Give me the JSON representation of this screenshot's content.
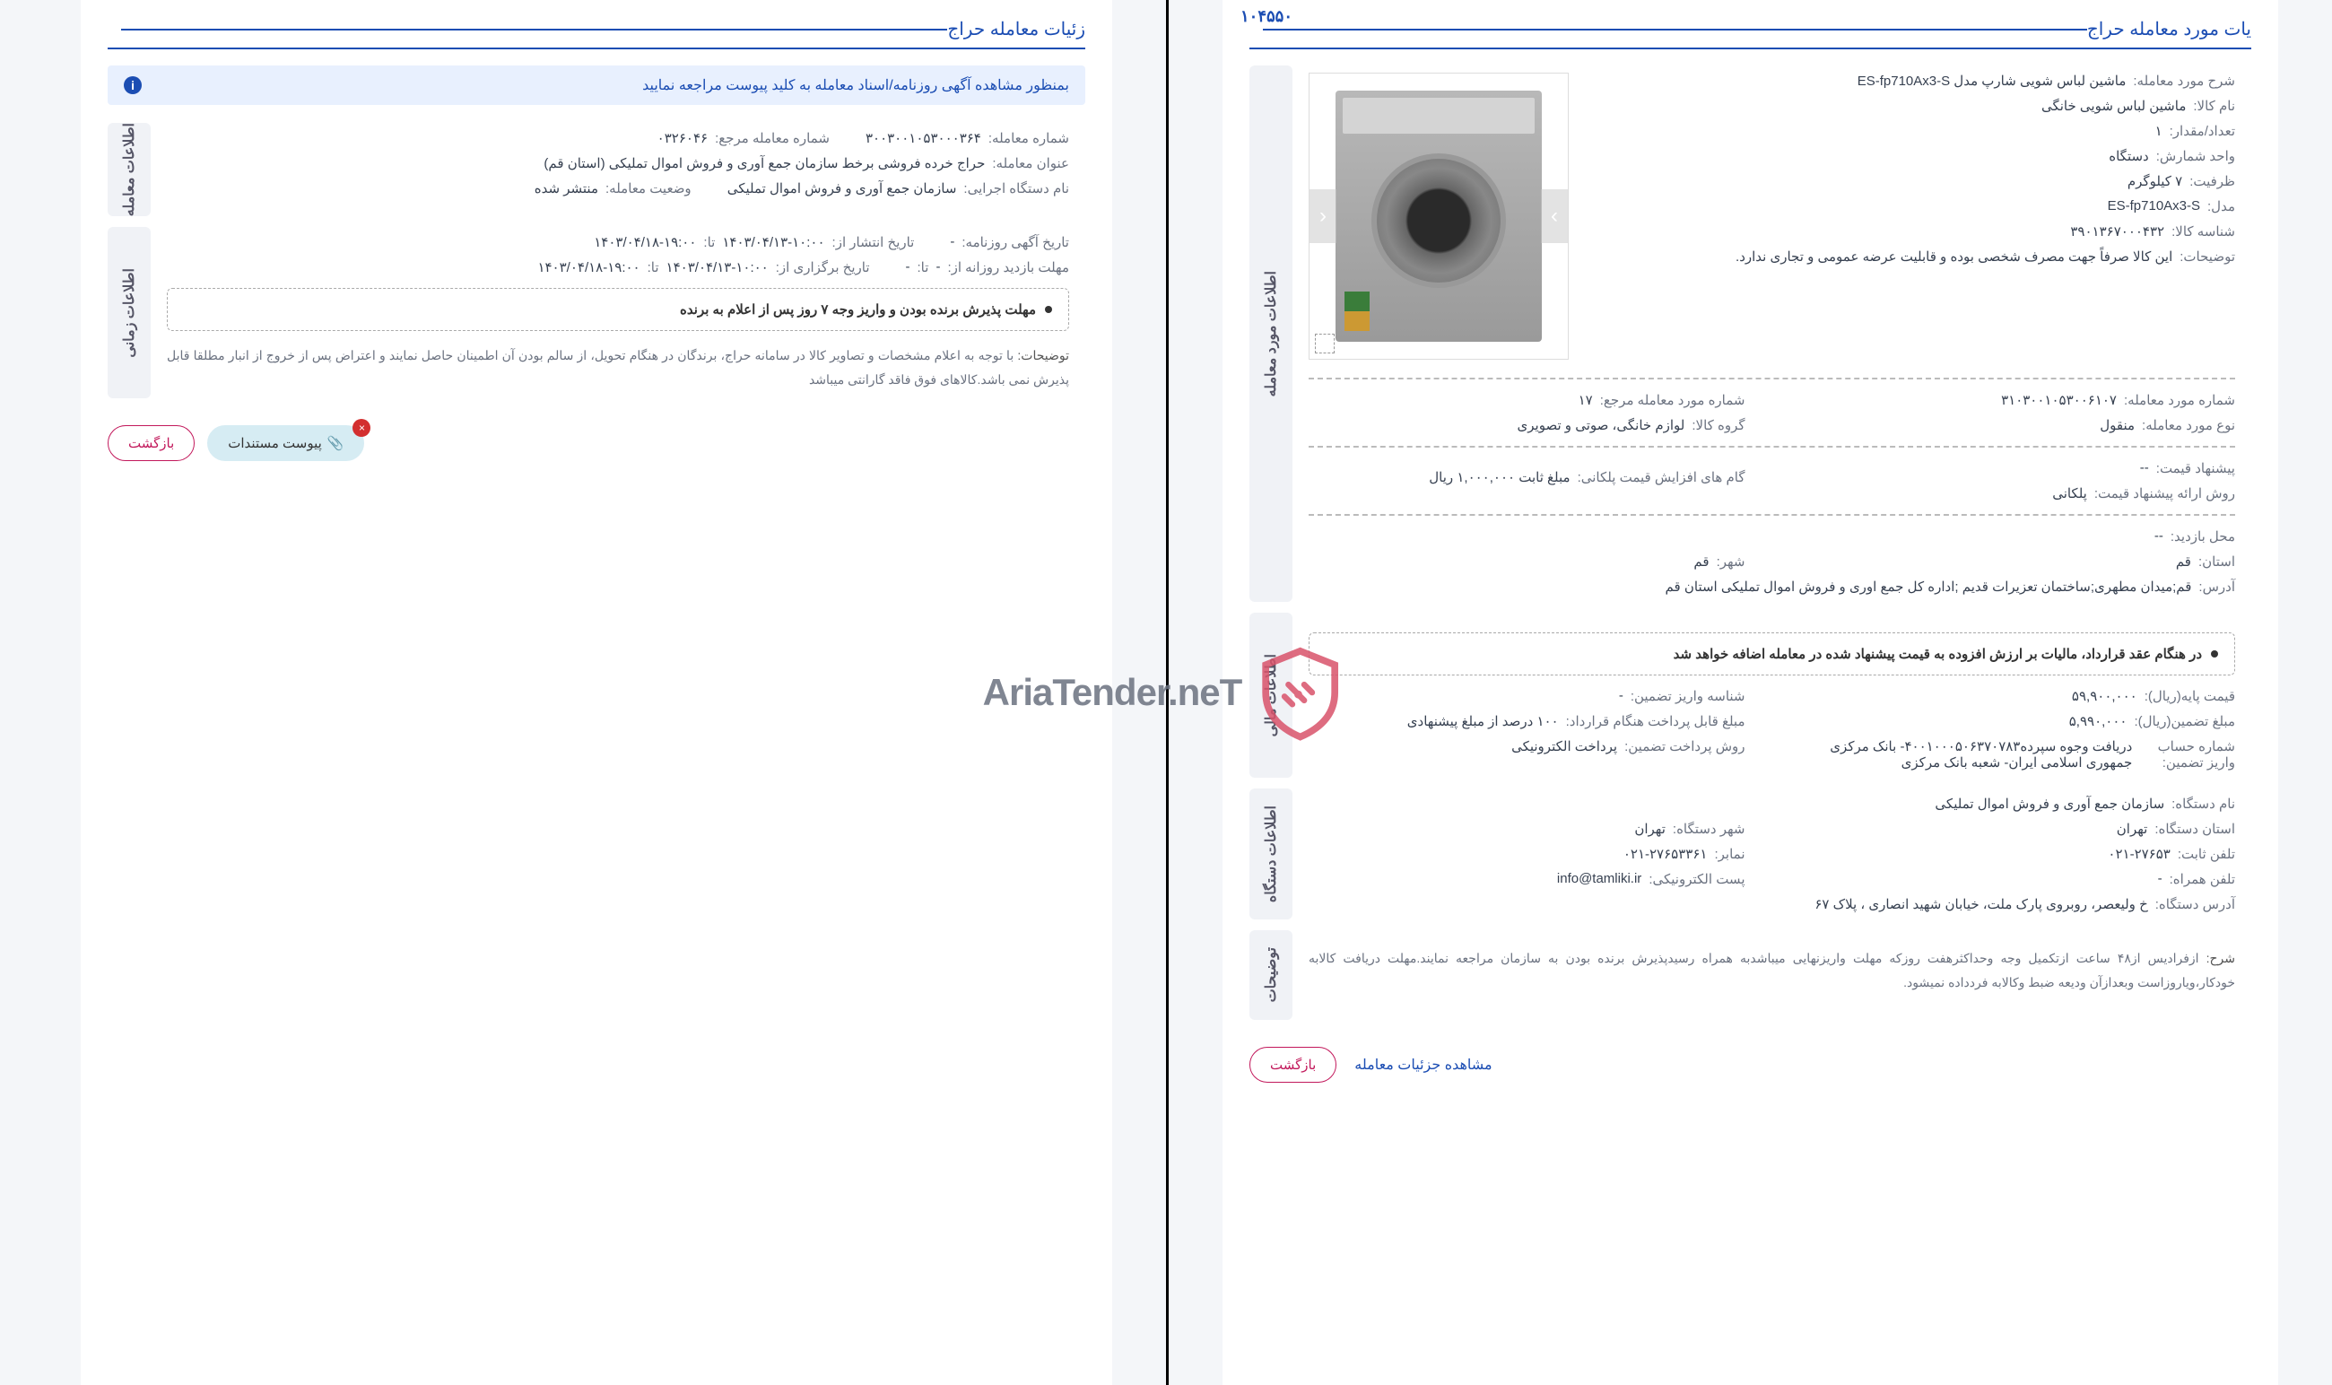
{
  "page_number": "۱۰۴۵۵۰",
  "left": {
    "header": "زئیات معامله حراج",
    "banner": "بمنظور مشاهده آگهی روزنامه/اسناد معامله به کلید پیوست مراجعه نمایید",
    "box_transaction": {
      "tab": "اطلاعات معامله",
      "fields": {
        "num_label": "شماره معامله:",
        "num_value": "۳۰۰۳۰۰۱۰۵۳۰۰۰۳۶۴",
        "ref_label": "شماره معامله مرجع:",
        "ref_value": "۰۳۲۶۰۴۶",
        "subject_label": "عنوان معامله:",
        "subject_value": "حراج خرده فروشی برخط سازمان جمع آوری و فروش اموال تملیکی (استان قم)",
        "org_label": "نام دستگاه اجرایی:",
        "org_value": "سازمان جمع آوری و فروش اموال تملیکی",
        "status_label": "وضعیت معامله:",
        "status_value": "منتشر شده"
      }
    },
    "box_time": {
      "tab": "اطلاعات زمانی",
      "fields": {
        "news_label": "تاریخ آگهی روزنامه:",
        "news_value": "-",
        "pub_label": "تاریخ انتشار از:",
        "pub_value": "۱۴۰۳/۰۴/۱۳-۱۰:۰۰",
        "pub_to": "۱۴۰۳/۰۴/۱۸-۱۹:۰۰",
        "visit_label": "مهلت بازدید روزانه از:",
        "visit_value": "-",
        "visit_to_label": "تا:",
        "visit_to": "-",
        "hold_label": "تاریخ برگزاری از:",
        "hold_value": "۱۴۰۳/۰۴/۱۳-۱۰:۰۰",
        "hold_to": "۱۴۰۳/۰۴/۱۸-۱۹:۰۰",
        "to_label": "تا:"
      },
      "deadline": "مهلت پذیرش برنده بودن و واریز وجه ۷ روز پس از اعلام به برنده",
      "note_label": "توضیحات:",
      "note": "با توجه به اعلام مشخصات و تصاویر کالا در سامانه حراج، برندگان در هنگام تحویل، از سالم بودن آن اطمینان حاصل نمایند و اعتراض پس از خروج از انبار مطلقا قابل پذیرش نمی باشد.کالاهای فوق فاقد گارانتی میباشد"
    },
    "buttons": {
      "attach": "پیوست مستندات",
      "back": "بازگشت"
    }
  },
  "right": {
    "header": "یات مورد معامله حراج",
    "box_item": {
      "tab": "اطلاعات مورد معامله",
      "fields": {
        "desc_label": "شرح مورد معامله:",
        "desc_value": "ماشین لباس شویی شارپ مدل ES-fp710Ax3-S",
        "name_label": "نام کالا:",
        "name_value": "ماشین لباس شویی خانگی",
        "qty_label": "تعداد/مقدار:",
        "qty_value": "۱",
        "unit_label": "واحد شمارش:",
        "unit_value": "دستگاه",
        "cap_label": "ظرفیت:",
        "cap_value": "۷ کیلوگرم",
        "model_label": "مدل:",
        "model_value": "ES-fp710Ax3-S",
        "sku_label": "شناسه کالا:",
        "sku_value": "۳۹۰۱۳۶۷۰۰۰۴۳۲",
        "tnote_label": "توضیحات:",
        "tnote_value": "این کالا صرفاً جهت مصرف شخصی بوده و قابلیت عرضه عمومی و تجاری ندارد.",
        "tnum_label": "شماره مورد معامله:",
        "tnum_value": "۳۱۰۳۰۰۱۰۵۳۰۰۶۱۰۷",
        "tref_label": "شماره مورد معامله مرجع:",
        "tref_value": "۱۷",
        "ttype_label": "نوع مورد معامله:",
        "ttype_value": "منقول",
        "group_label": "گروه کالا:",
        "group_value": "لوازم خانگی، صوتی و تصویری",
        "bid_label": "پیشنهاد قیمت:",
        "bid_value": "--",
        "method_label": "روش ارائه پیشنهاد قیمت:",
        "method_value": "پلکانی",
        "step_label": "گام های افزایش قیمت پلکانی:",
        "step_value": "مبلغ ثابت ۱,۰۰۰,۰۰۰ ریال",
        "vloc_label": "محل بازدید:",
        "vloc_value": "--",
        "prov_label": "استان:",
        "prov_value": "قم",
        "city_label": "شهر:",
        "city_value": "قم",
        "addr_label": "آدرس:",
        "addr_value": "قم;میدان مطهری;ساختمان تعزیرات قدیم ;اداره کل جمع اوری و فروش اموال تملیکی استان قم"
      }
    },
    "box_fin": {
      "tab": "اطلاعات مالی",
      "vat": "در هنگام عقد قرارداد، مالیات بر ارزش افزوده به قیمت پیشنهاد شده در معامله اضافه خواهد شد",
      "fields": {
        "base_label": "قیمت پایه(ریال):",
        "base_value": "۵۹,۹۰۰,۰۰۰",
        "gid_label": "شناسه واریز تضمین:",
        "gid_value": "-",
        "gamount_label": "مبلغ تضمین(ریال):",
        "gamount_value": "۵,۹۹۰,۰۰۰",
        "pay_label": "مبلغ قابل پرداخت هنگام قرارداد:",
        "pay_value": "۱۰۰ درصد از مبلغ پیشنهادی",
        "acc_label": "شماره حساب واریز تضمین:",
        "acc_value": "دریافت وجوه سپرده۴۰۰۱۰۰۰۵۰۶۳۷۰۷۸۳- بانک مرکزی جمهوری اسلامی ایران- شعبه بانک مرکزی",
        "gmethod_label": "روش پرداخت تضمین:",
        "gmethod_value": "پرداخت الکترونیکی"
      }
    },
    "box_org": {
      "tab": "اطلاعات دستگاه",
      "fields": {
        "org_label": "نام دستگاه:",
        "org_value": "سازمان جمع آوری و فروش اموال تملیکی",
        "oprov_label": "استان دستگاه:",
        "oprov_value": "تهران",
        "ocity_label": "شهر دستگاه:",
        "ocity_value": "تهران",
        "tel_label": "تلفن ثابت:",
        "tel_value": "۰۲۱-۲۷۶۵۳",
        "fax_label": "نمابر:",
        "fax_value": "۰۲۱-۲۷۶۵۳۳۶۱",
        "mob_label": "تلفن همراه:",
        "mob_value": "-",
        "email_label": "پست الکترونیکی:",
        "email_value": "info@tamliki.ir",
        "oaddr_label": "آدرس دستگاه:",
        "oaddr_value": "خ ولیعصر، روبروی پارک ملت، خیابان شهید انصاری ، پلاک ۶۷"
      }
    },
    "box_explain": {
      "tab": "توضیحات",
      "label": "شرح:",
      "text": "ازفرادیس از۴۸ ساعت ازتکمیل وجه وحداکثرهفت روزکه مهلت واریزنهایی میباشدبه همراه رسیدپذیرش برنده بودن به سازمان مراجعه نمایند.مهلت دریافت کالابه خودکار،ویاروزاست وبعدازآن ودیعه ضبط وکالابه فردداده نمیشود."
    },
    "buttons": {
      "link": "مشاهده جزئیات معامله",
      "back": "بازگشت"
    }
  },
  "watermark": "AriaTender.neT"
}
